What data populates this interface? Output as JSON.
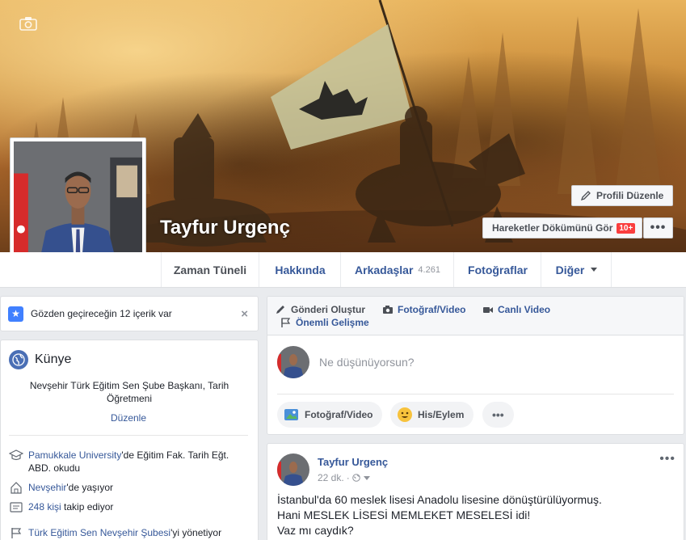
{
  "profile": {
    "name": "Tayfur Urgenç",
    "edit_profile_label": "Profili Düzenle",
    "activity_log_label": "Hareketler Dökümünü Gör",
    "activity_badge": "10+",
    "more_label": "•••"
  },
  "tabs": {
    "timeline": "Zaman Tüneli",
    "about": "Hakkında",
    "friends": "Arkadaşlar",
    "friends_count": "4.261",
    "photos": "Fotoğraflar",
    "more": "Diğer"
  },
  "review": {
    "text": "Gözden geçireceğin 12 içerik var",
    "close": "×"
  },
  "intro": {
    "title": "Künye",
    "bio": "Nevşehir Türk Eğitim Sen Şube Başkanı, Tarih Öğretmeni",
    "edit": "Düzenle",
    "education_link": "Pamukkale University",
    "education_rest": "'de Eğitim Fak. Tarih Eğt. ABD. okudu",
    "lives_link": "Nevşehir",
    "lives_rest": "'de yaşıyor",
    "followers_link": "248 kişi",
    "followers_rest": " takip ediyor",
    "manages_link": "Türk Eğitim Sen Nevşehir Şubesi",
    "manages_rest": "'yi yönetiyor"
  },
  "composer": {
    "create_post": "Gönderi Oluştur",
    "photo_video": "Fotoğraf/Video",
    "live_video": "Canlı Video",
    "life_event": "Önemli Gelişme",
    "placeholder": "Ne düşünüyorsun?",
    "pill_photo": "Fotoğraf/Video",
    "pill_feeling": "His/Eylem",
    "pill_more": "•••"
  },
  "post": {
    "author": "Tayfur Urgenç",
    "time": "22 dk.",
    "more": "•••",
    "line1": "İstanbul'da 60 meslek lisesi Anadolu lisesine dönüştürülüyormuş.",
    "line2": "Hani MESLEK LİSESİ MEMLEKET MESELESİ idi!",
    "line3": "Vaz mı caydık?"
  }
}
